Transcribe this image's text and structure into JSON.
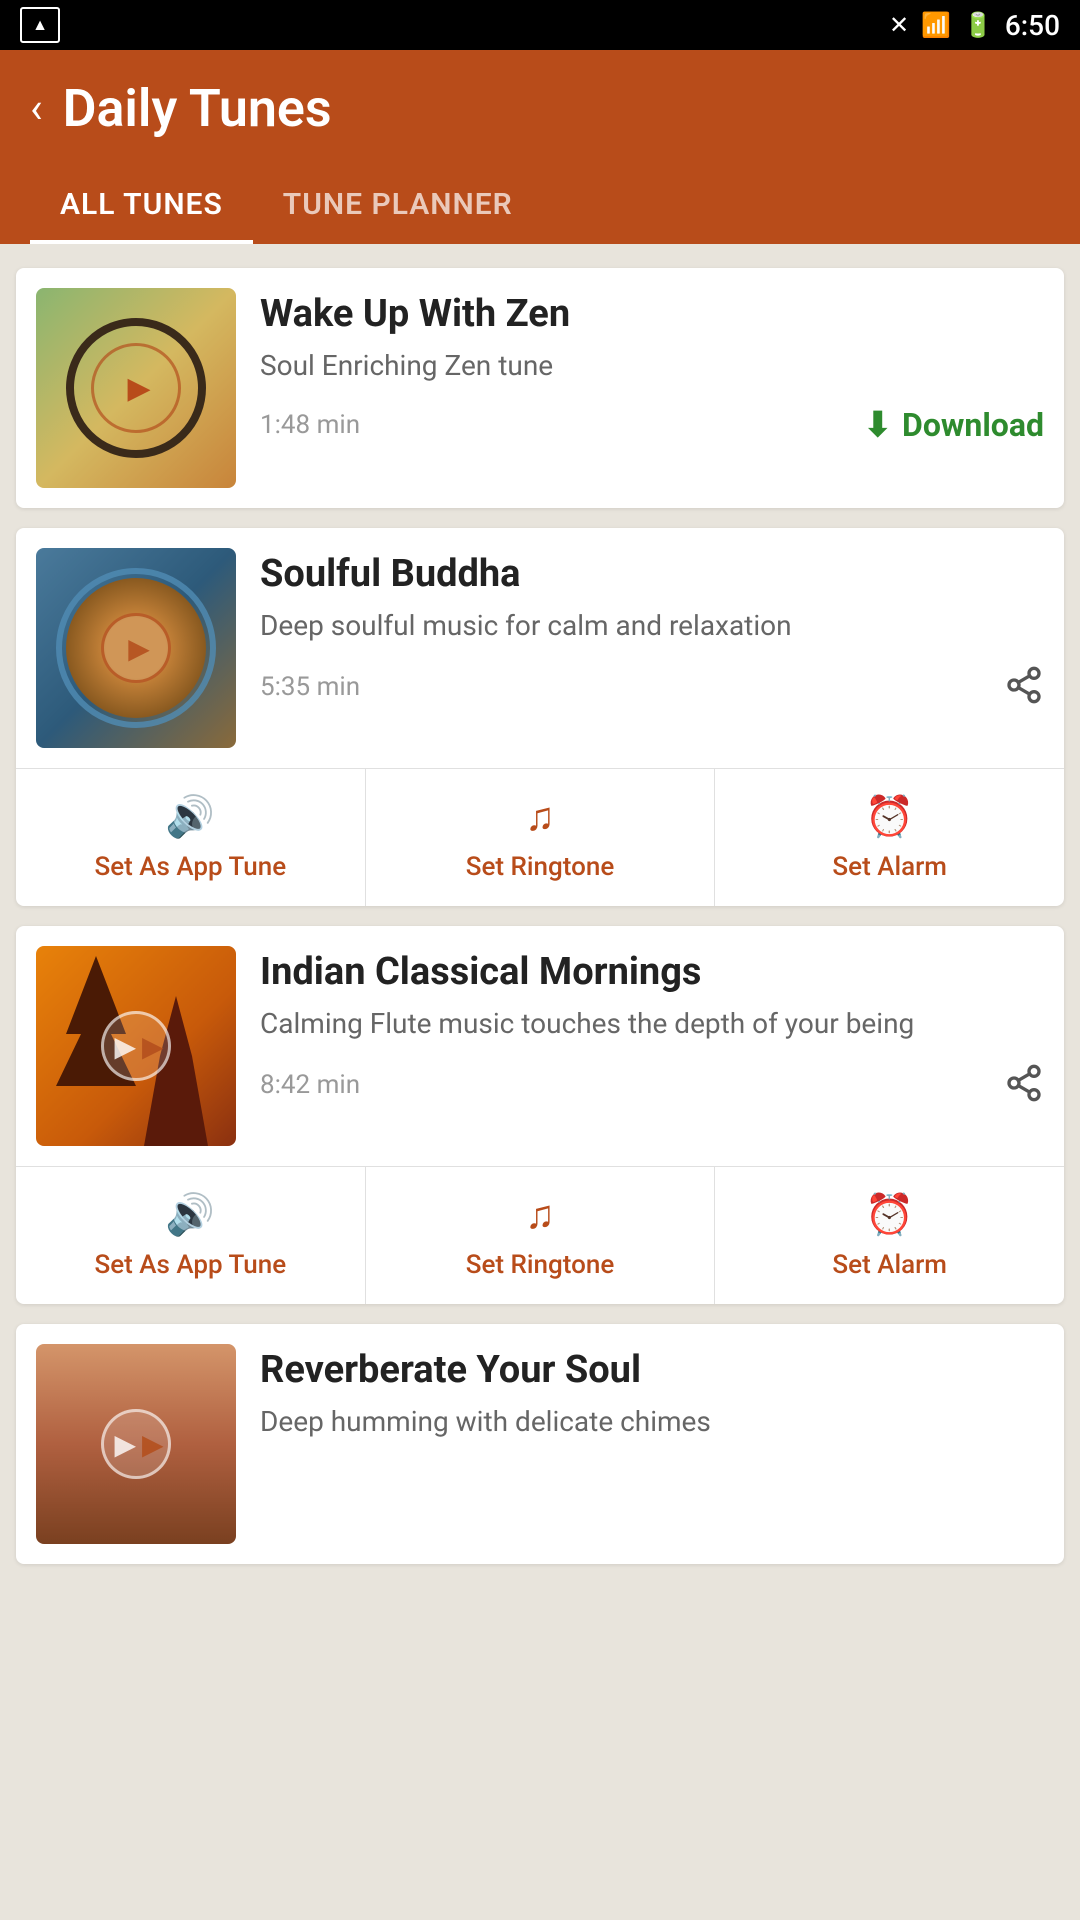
{
  "statusBar": {
    "time": "6:50",
    "batteryIcon": "🔋",
    "signalIcon": "📶"
  },
  "header": {
    "backLabel": "‹",
    "title": "Daily Tunes",
    "tabs": [
      {
        "id": "all-tunes",
        "label": "ALL TUNES",
        "active": true
      },
      {
        "id": "tune-planner",
        "label": "TUNE PLANNER",
        "active": false
      }
    ]
  },
  "tunes": [
    {
      "id": "wake-up-zen",
      "title": "Wake Up With Zen",
      "description": "Soul Enriching Zen tune",
      "duration": "1:48 min",
      "hasDownload": true,
      "downloadLabel": "Download",
      "hasActions": false,
      "thumbnail": "zen"
    },
    {
      "id": "soulful-buddha",
      "title": "Soulful Buddha",
      "description": "Deep soulful music for calm and relaxation",
      "duration": "5:35 min",
      "hasDownload": false,
      "hasActions": true,
      "thumbnail": "buddha",
      "actions": [
        {
          "id": "set-app-tune",
          "label": "Set As App Tune",
          "icon": "speaker"
        },
        {
          "id": "set-ringtone",
          "label": "Set Ringtone",
          "icon": "music"
        },
        {
          "id": "set-alarm",
          "label": "Set Alarm",
          "icon": "alarm"
        }
      ]
    },
    {
      "id": "indian-classical",
      "title": "Indian Classical Mornings",
      "description": "Calming Flute music touches the depth of your being",
      "duration": "8:42 min",
      "hasDownload": false,
      "hasActions": true,
      "thumbnail": "indian",
      "actions": [
        {
          "id": "set-app-tune",
          "label": "Set As App Tune",
          "icon": "speaker"
        },
        {
          "id": "set-ringtone",
          "label": "Set Ringtone",
          "icon": "music"
        },
        {
          "id": "set-alarm",
          "label": "Set Alarm",
          "icon": "alarm"
        }
      ]
    },
    {
      "id": "reverberate-soul",
      "title": "Reverberate Your Soul",
      "description": "Deep humming with delicate chimes",
      "thumbnail": "reverberate"
    }
  ],
  "icons": {
    "speaker": "🔊",
    "music": "🎵",
    "alarm": "⏰",
    "share": "share",
    "download": "⬇"
  }
}
